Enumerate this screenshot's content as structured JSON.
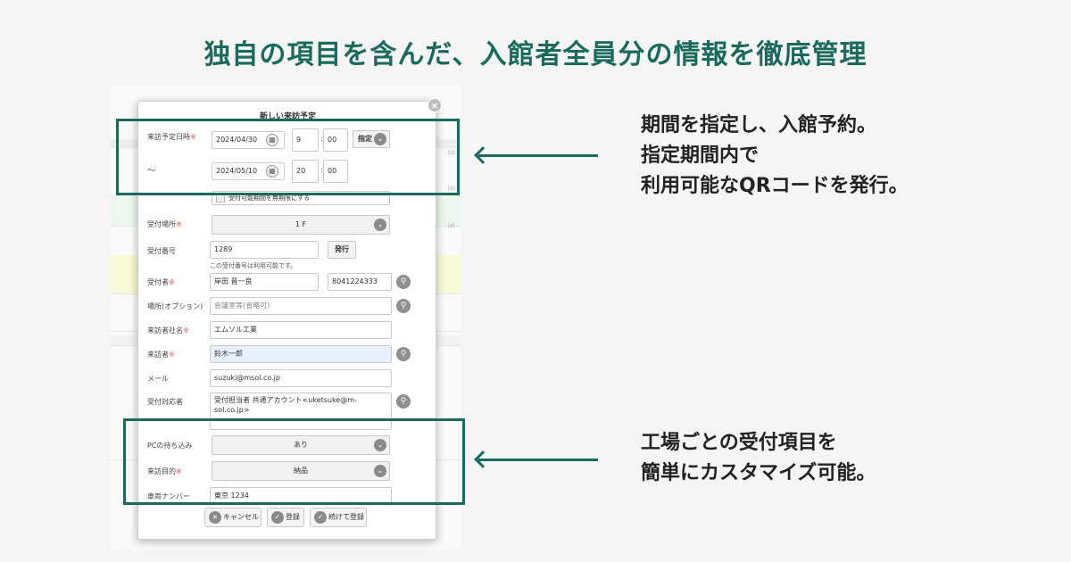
{
  "headline": "独自の項目を含んだ、入館者全員分の情報を徹底管理",
  "background_app": {
    "tags": [
      "(d)",
      "(d)",
      "(d)"
    ]
  },
  "modal": {
    "title": "新しい来訪予定",
    "close_icon": "close-icon",
    "visit_datetime": {
      "label": "来訪予定日時",
      "required_mark": "※",
      "start_date": "2024/04/30",
      "start_hour": "9",
      "start_min": "00",
      "specify_button": "指定",
      "range_sep": "～",
      "end_date": "2024/05/10",
      "end_hour": "20",
      "end_min": "00",
      "time_colon": ":"
    },
    "validity_checkbox_label": "受付可能期間を無期限にする",
    "reception_place": {
      "label": "受付場所",
      "required_mark": "※",
      "value": "1 F"
    },
    "reception_number": {
      "label": "受付番号",
      "value": "1289",
      "issue_button": "発行",
      "note": "この受付番号は利用可能です。"
    },
    "receiver": {
      "label": "受付者",
      "required_mark": "※",
      "name": "岸田 晋一良",
      "phone": "8041224333"
    },
    "location_option": {
      "label": "場所(オプション)",
      "placeholder": "会議室等(省略可)"
    },
    "visitor_company": {
      "label": "来訪者社名",
      "required_mark": "※",
      "value": "エムソル工業"
    },
    "visitor": {
      "label": "来訪者",
      "required_mark": "※",
      "value": "鈴木一郎"
    },
    "email": {
      "label": "メール",
      "value": "suzuki@msol.co.jp"
    },
    "handler": {
      "label": "受付対応者",
      "value_line1": "受付担当者 共通アカウント<uketsuke@m-",
      "value_line2": "sol.co.jp>"
    },
    "pc_bring": {
      "label": "PCの持ち込み",
      "value": "あり"
    },
    "visit_purpose": {
      "label": "来訪目的",
      "required_mark": "※",
      "value": "納品"
    },
    "vehicle_number": {
      "label": "車両ナンバー",
      "value": "東京 1234"
    },
    "footer": {
      "cancel": "キャンセル",
      "register": "登録",
      "register_continue": "続けて登録"
    }
  },
  "callouts": {
    "top": [
      "期間を指定し、入館予約。",
      "指定期間内で",
      "利用可能なQRコードを発行。"
    ],
    "bottom": [
      "工場ごとの受付項目を",
      "簡単にカスタマイズ可能。"
    ]
  },
  "colors": {
    "accent": "#1a6b5e",
    "required": "#e05555"
  },
  "icons": {
    "calendar": "calendar-icon",
    "chevron": "chevron-down-icon",
    "lookup": "search-icon",
    "arrow": "arrow-left-icon"
  }
}
